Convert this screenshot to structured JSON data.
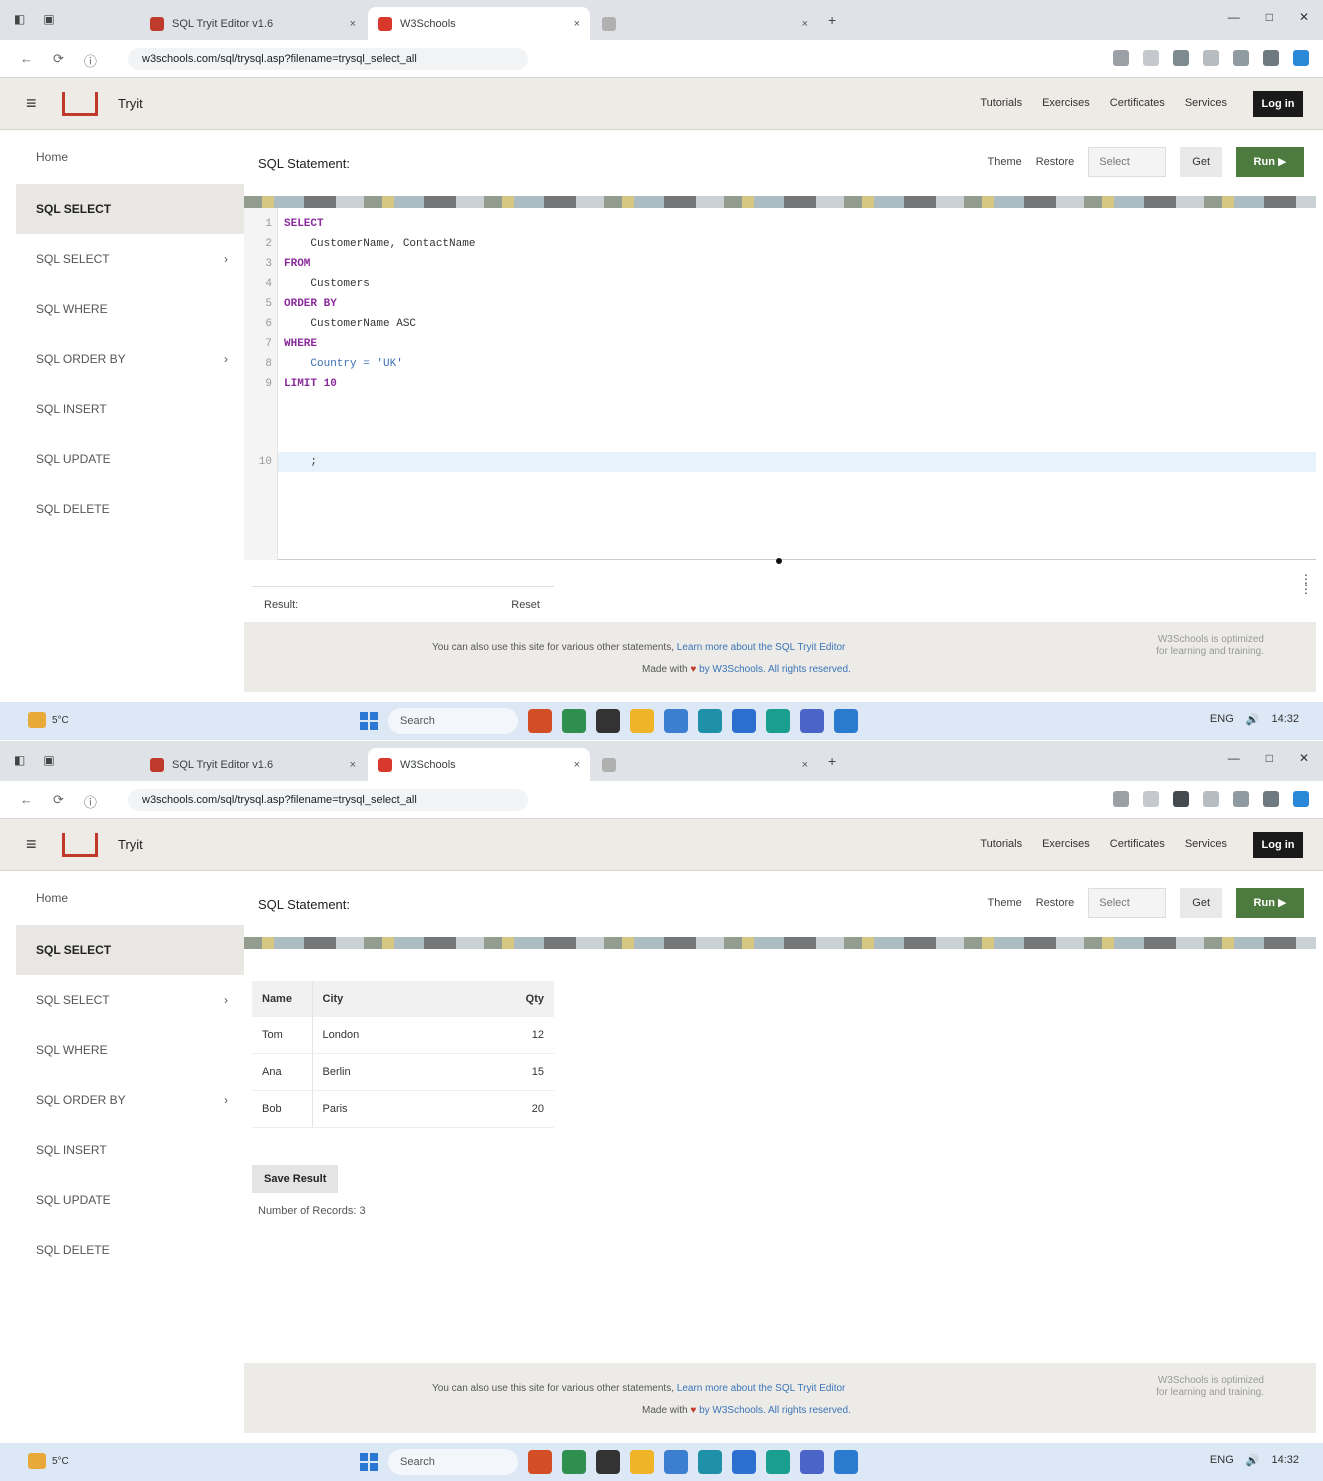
{
  "browser": {
    "tabs": [
      {
        "title": "SQL Tryit Editor v1.6",
        "favicon_color": "#c03a2b",
        "active": false
      },
      {
        "title": "W3Schools",
        "favicon_color": "#d9382c",
        "active": true
      },
      {
        "title": "",
        "favicon_color": "#b0b0b0",
        "active": false
      }
    ],
    "new_tab": "+",
    "tab_close": "×",
    "window_controls": [
      "—",
      "□",
      "✕"
    ],
    "url": "w3schools.com/sql/trysql.asp?filename=trysql_select_all",
    "nav": [
      "←",
      "⟳",
      "ⓘ"
    ]
  },
  "app": {
    "menu_icon": "≡",
    "brand": "Tryit",
    "header_links": [
      "Tutorials",
      "Exercises",
      "Certificates",
      "Services"
    ],
    "login": "Log in"
  },
  "sidebar": {
    "home": "Home",
    "section": "SQL SELECT",
    "items_a": [
      "SQL SELECT",
      "SQL WHERE",
      "SQL ORDER BY",
      "SQL INSERT",
      "SQL UPDATE",
      "SQL DELETE"
    ],
    "items_b": [
      "SQL SELECT",
      "SQL WHERE",
      "SQL ORDER BY",
      "SQL INSERT",
      "SQL UPDATE",
      "SQL DELETE"
    ],
    "arrow": "›"
  },
  "main": {
    "title": "SQL Statement:",
    "tools": {
      "theme": "Theme",
      "restore": "Restore",
      "select_placeholder": "Select",
      "get": "Get",
      "run": "Run ▶"
    },
    "code_lines": [
      {
        "n": "1",
        "text": "SELECT"
      },
      {
        "n": "2",
        "text": "    CustomerName, ContactName"
      },
      {
        "n": "3",
        "text": "FROM"
      },
      {
        "n": "4",
        "text": "    Customers"
      },
      {
        "n": "5",
        "text": "ORDER BY"
      },
      {
        "n": "6",
        "text": "    CustomerName ASC"
      },
      {
        "n": "7",
        "text": "WHERE"
      },
      {
        "n": "8",
        "text": "    Country = 'UK'"
      },
      {
        "n": "9",
        "text": "LIMIT 10"
      },
      {
        "n": "10",
        "text": "    ;"
      }
    ],
    "result_headers": [
      "Result:",
      "",
      "Reset"
    ],
    "table": {
      "columns": [
        "Name",
        "City",
        "Qty"
      ],
      "rows": [
        [
          "Tom",
          "London",
          "12"
        ],
        [
          "Ana",
          "Berlin",
          "15"
        ],
        [
          "Bob",
          "Paris",
          "20"
        ]
      ]
    },
    "save_button": "Save Result",
    "row_count": "Number of Records: 3"
  },
  "footer": {
    "line1_text": "You can also use this site for various other statements, ",
    "line1_link": "Learn more about the SQL Tryit Editor",
    "line2_pre": "Made with ",
    "heart": "♥",
    "line2_link": "by W3Schools. All rights reserved.",
    "note1": "W3Schools is optimized",
    "note2": "for learning and training."
  },
  "taskbar": {
    "weather": "5°C",
    "search": "Search",
    "tray": [
      "ENG",
      "🔊",
      "14:32"
    ],
    "app_colors": [
      "#d34e24",
      "#2f8f4e",
      "#333333",
      "#f0b429",
      "#3c7fd0",
      "#1e90a8",
      "#2b6fd0",
      "#1a9e8f",
      "#4b64c8",
      "#2a7bd0"
    ]
  }
}
